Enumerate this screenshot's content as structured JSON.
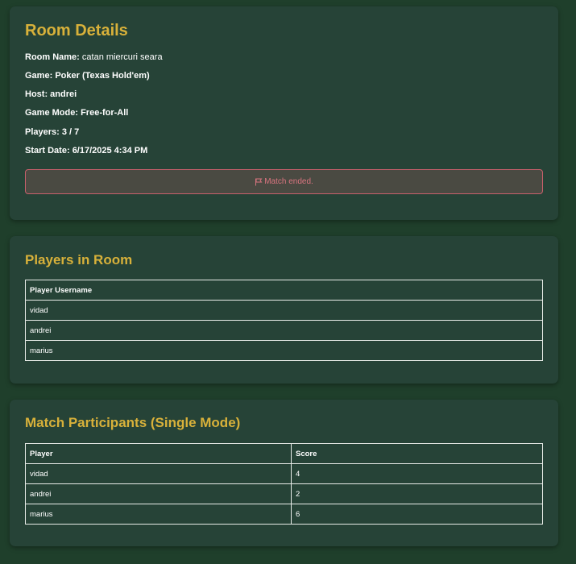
{
  "room": {
    "title": "Room Details",
    "details": [
      {
        "label": "Room Name:",
        "value": "catan miercuri seara"
      },
      {
        "label": "Game:",
        "value": "Poker (Texas Hold'em)"
      },
      {
        "label": "Host:",
        "value": "andrei"
      },
      {
        "label": "Game Mode:",
        "value": "Free-for-All"
      },
      {
        "label": "Players:",
        "value": "3 / 7"
      },
      {
        "label": "Start Date:",
        "value": "6/17/2025 4:34 PM"
      }
    ],
    "alert": {
      "icon": "flag-icon",
      "text": "Match ended."
    }
  },
  "players": {
    "title": "Players in Room",
    "header": "Player Username",
    "rows": [
      "vidad",
      "andrei",
      "marius"
    ]
  },
  "participants": {
    "title": "Match Participants (Single Mode)",
    "headers": [
      "Player",
      "Score"
    ],
    "rows": [
      {
        "player": "vidad",
        "score": "4"
      },
      {
        "player": "andrei",
        "score": "2"
      },
      {
        "player": "marius",
        "score": "6"
      }
    ]
  },
  "colors": {
    "background": "#1f3f2b",
    "card": "#264337",
    "title": "#d8b13a",
    "alert_border": "#c8606c",
    "alert_text": "#d8747f"
  }
}
